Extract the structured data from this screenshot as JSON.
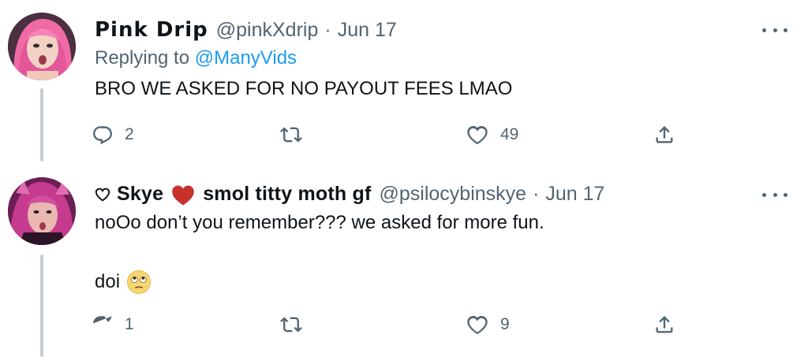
{
  "tweets": [
    {
      "display_name": "Pink Drip",
      "handle": "@pinkXdrip",
      "separator": "·",
      "date": "Jun 17",
      "reply_prefix": "Replying to ",
      "reply_mention": "@ManyVids",
      "text": "BRO WE ASKED FOR NO PAYOUT FEES LMAO",
      "reply_count": "2",
      "retweet_count": "",
      "like_count": "49",
      "avatar_icon": "avatar-pink-hair",
      "accent_color": "#f27fb0"
    },
    {
      "display_name_prefix_icon": "outline-heart-icon",
      "display_name_part1": "Skye",
      "display_name_heart_icon": "red-heart-icon",
      "display_name_part2": "smol titty moth gf",
      "handle": "@psilocybinskye",
      "separator": "·",
      "date": "Jun 17",
      "text_line_1": "noOo don’t you remember??? we asked for more fun.",
      "text_line_2": "doi",
      "emoji": "face-with-rolling-eyes",
      "reply_count": "1",
      "retweet_count": "",
      "like_count": "9",
      "avatar_icon": "avatar-purple-hair",
      "accent_color": "#b5307b"
    }
  ],
  "colors": {
    "text_primary": "#0f1419",
    "text_secondary": "#536471",
    "link": "#1d9bf0",
    "thread_line": "#c4cfd6",
    "heart_red": "#c9302c"
  },
  "icons": {
    "reply": "reply-icon",
    "retweet": "retweet-icon",
    "like": "heart-icon",
    "share": "share-icon",
    "more": "more-icon"
  }
}
